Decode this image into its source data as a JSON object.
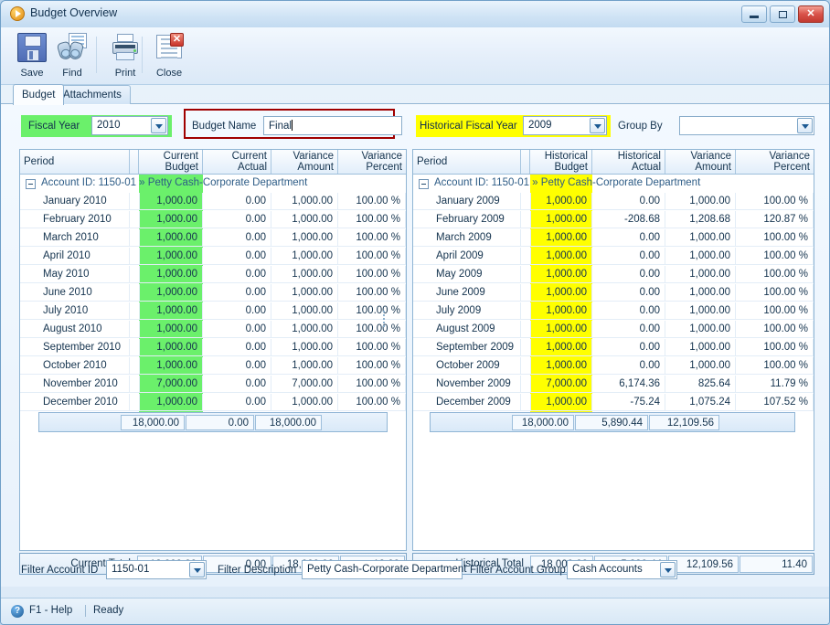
{
  "window": {
    "title": "Budget Overview",
    "icon": "play-circle-icon",
    "buttons": {
      "minimize": "minimize",
      "maximize": "maximize",
      "close": "✕"
    }
  },
  "toolbar": {
    "items": [
      {
        "label": "Save",
        "icon": "floppy-disk-icon"
      },
      {
        "label": "Find",
        "icon": "binoculars-icon"
      },
      {
        "label": "Print",
        "icon": "printer-icon"
      },
      {
        "label": "Close",
        "icon": "close-window-icon"
      }
    ]
  },
  "tabs": [
    {
      "label": "Budget",
      "active": true
    },
    {
      "label": "Attachments",
      "active": false
    }
  ],
  "filters": {
    "fiscal_year_label": "Fiscal Year",
    "fiscal_year_value": "2010",
    "budget_name_label": "Budget Name",
    "budget_name_value": "Final",
    "historical_fiscal_year_label": "Historical Fiscal Year",
    "historical_fiscal_year_value": "2009",
    "group_by_label": "Group By",
    "group_by_value": ""
  },
  "left_grid": {
    "columns": [
      "Period",
      "",
      "Current\nBudget",
      "Current\nActual",
      "Variance\nAmount",
      "Variance\nPercent"
    ],
    "col_period": "Period",
    "col_budget_line1": "Current",
    "col_budget_line2": "Budget",
    "col_actual_line1": "Current",
    "col_actual_line2": "Actual",
    "col_varamt_line1": "Variance",
    "col_varamt_line2": "Amount",
    "col_varpct_line1": "Variance",
    "col_varpct_line2": "Percent",
    "group_label": "Account ID: 1150-01 » Petty Cash-Corporate Department",
    "rows": [
      {
        "period": "January 2010",
        "budget": "1,000.00",
        "actual": "0.00",
        "variance_amount": "1,000.00",
        "variance_percent": "100.00 %"
      },
      {
        "period": "February 2010",
        "budget": "1,000.00",
        "actual": "0.00",
        "variance_amount": "1,000.00",
        "variance_percent": "100.00 %"
      },
      {
        "period": "March 2010",
        "budget": "1,000.00",
        "actual": "0.00",
        "variance_amount": "1,000.00",
        "variance_percent": "100.00 %"
      },
      {
        "period": "April 2010",
        "budget": "1,000.00",
        "actual": "0.00",
        "variance_amount": "1,000.00",
        "variance_percent": "100.00 %"
      },
      {
        "period": "May 2010",
        "budget": "1,000.00",
        "actual": "0.00",
        "variance_amount": "1,000.00",
        "variance_percent": "100.00 %"
      },
      {
        "period": "June 2010",
        "budget": "1,000.00",
        "actual": "0.00",
        "variance_amount": "1,000.00",
        "variance_percent": "100.00 %"
      },
      {
        "period": "July 2010",
        "budget": "1,000.00",
        "actual": "0.00",
        "variance_amount": "1,000.00",
        "variance_percent": "100.00 %"
      },
      {
        "period": "August 2010",
        "budget": "1,000.00",
        "actual": "0.00",
        "variance_amount": "1,000.00",
        "variance_percent": "100.00 %"
      },
      {
        "period": "September 2010",
        "budget": "1,000.00",
        "actual": "0.00",
        "variance_amount": "1,000.00",
        "variance_percent": "100.00 %"
      },
      {
        "period": "October 2010",
        "budget": "1,000.00",
        "actual": "0.00",
        "variance_amount": "1,000.00",
        "variance_percent": "100.00 %"
      },
      {
        "period": "November 2010",
        "budget": "7,000.00",
        "actual": "0.00",
        "variance_amount": "7,000.00",
        "variance_percent": "100.00 %"
      },
      {
        "period": "December 2010",
        "budget": "1,000.00",
        "actual": "0.00",
        "variance_amount": "1,000.00",
        "variance_percent": "100.00 %"
      }
    ],
    "subtotal": {
      "budget": "18,000.00",
      "actual": "0.00",
      "variance_amount": "18,000.00",
      "variance_percent": ""
    },
    "total": {
      "label": "Current Total",
      "budget": "18,000.00",
      "actual": "0.00",
      "variance_amount": "18,000.00",
      "variance_percent": "12.00"
    }
  },
  "right_grid": {
    "col_period": "Period",
    "col_budget_line1": "Historical",
    "col_budget_line2": "Budget",
    "col_actual_line1": "Historical",
    "col_actual_line2": "Actual",
    "col_varamt_line1": "Variance",
    "col_varamt_line2": "Amount",
    "col_varpct_line1": "Variance",
    "col_varpct_line2": "Percent",
    "group_label": "Account ID: 1150-01 » Petty Cash-Corporate Department",
    "rows": [
      {
        "period": "January 2009",
        "budget": "1,000.00",
        "actual": "0.00",
        "variance_amount": "1,000.00",
        "variance_percent": "100.00 %"
      },
      {
        "period": "February 2009",
        "budget": "1,000.00",
        "actual": "-208.68",
        "variance_amount": "1,208.68",
        "variance_percent": "120.87 %"
      },
      {
        "period": "March 2009",
        "budget": "1,000.00",
        "actual": "0.00",
        "variance_amount": "1,000.00",
        "variance_percent": "100.00 %"
      },
      {
        "period": "April 2009",
        "budget": "1,000.00",
        "actual": "0.00",
        "variance_amount": "1,000.00",
        "variance_percent": "100.00 %"
      },
      {
        "period": "May 2009",
        "budget": "1,000.00",
        "actual": "0.00",
        "variance_amount": "1,000.00",
        "variance_percent": "100.00 %"
      },
      {
        "period": "June 2009",
        "budget": "1,000.00",
        "actual": "0.00",
        "variance_amount": "1,000.00",
        "variance_percent": "100.00 %"
      },
      {
        "period": "July 2009",
        "budget": "1,000.00",
        "actual": "0.00",
        "variance_amount": "1,000.00",
        "variance_percent": "100.00 %"
      },
      {
        "period": "August 2009",
        "budget": "1,000.00",
        "actual": "0.00",
        "variance_amount": "1,000.00",
        "variance_percent": "100.00 %"
      },
      {
        "period": "September 2009",
        "budget": "1,000.00",
        "actual": "0.00",
        "variance_amount": "1,000.00",
        "variance_percent": "100.00 %"
      },
      {
        "period": "October 2009",
        "budget": "1,000.00",
        "actual": "0.00",
        "variance_amount": "1,000.00",
        "variance_percent": "100.00 %"
      },
      {
        "period": "November 2009",
        "budget": "7,000.00",
        "actual": "6,174.36",
        "variance_amount": "825.64",
        "variance_percent": "11.79 %"
      },
      {
        "period": "December 2009",
        "budget": "1,000.00",
        "actual": "-75.24",
        "variance_amount": "1,075.24",
        "variance_percent": "107.52 %"
      }
    ],
    "subtotal": {
      "budget": "18,000.00",
      "actual": "5,890.44",
      "variance_amount": "12,109.56",
      "variance_percent": ""
    },
    "total": {
      "label": "Historical Total",
      "budget": "18,000.00",
      "actual": "5,890.44",
      "variance_amount": "12,109.56",
      "variance_percent": "11.40"
    }
  },
  "bottom_filters": {
    "account_id_label": "Filter Account ID",
    "account_id_value": "1150-01",
    "description_label": "Filter Description",
    "description_value": "Petty Cash-Corporate Department",
    "account_group_label": "Filter Account Group",
    "account_group_value": "Cash Accounts"
  },
  "statusbar": {
    "help_icon": "?",
    "help_text": "F1 - Help",
    "status_text": "Ready"
  },
  "colors": {
    "highlight_current": "#6bf06b",
    "highlight_historical": "#ffff00",
    "focus_outline": "#a00000"
  }
}
